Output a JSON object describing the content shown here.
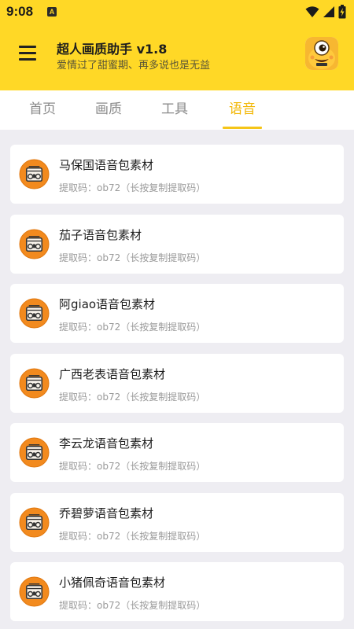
{
  "status_bar": {
    "time": "9:08",
    "notification_letter": "A",
    "icons": [
      "wifi-icon",
      "signal-icon",
      "battery-icon"
    ]
  },
  "header": {
    "title": "超人画质助手 v1.8",
    "subtitle": "爱情过了甜蜜期、再多说也是无益",
    "menu_icon": "hamburger-menu-icon",
    "avatar_icon": "yellow-monster-avatar-icon",
    "background_color": "#ffd826"
  },
  "tabs": [
    {
      "label": "首页",
      "active": false
    },
    {
      "label": "画质",
      "active": false
    },
    {
      "label": "工具",
      "active": false
    },
    {
      "label": "语音",
      "active": true
    }
  ],
  "accent_color": "#f5c518",
  "items": [
    {
      "title": "马保国语音包素材",
      "subtitle": "提取码：ob72（长按复制提取码）",
      "icon": "radio-icon"
    },
    {
      "title": "茄子语音包素材",
      "subtitle": "提取码：ob72（长按复制提取码）",
      "icon": "radio-icon"
    },
    {
      "title": "阿giao语音包素材",
      "subtitle": "提取码：ob72（长按复制提取码）",
      "icon": "radio-icon"
    },
    {
      "title": "广西老表语音包素材",
      "subtitle": "提取码：ob72（长按复制提取码）",
      "icon": "radio-icon"
    },
    {
      "title": "李云龙语音包素材",
      "subtitle": "提取码：ob72（长按复制提取码）",
      "icon": "radio-icon"
    },
    {
      "title": "乔碧萝语音包素材",
      "subtitle": "提取码：ob72（长按复制提取码）",
      "icon": "radio-icon"
    },
    {
      "title": "小猪佩奇语音包素材",
      "subtitle": "提取码：ob72（长按复制提取码）",
      "icon": "radio-icon"
    }
  ]
}
